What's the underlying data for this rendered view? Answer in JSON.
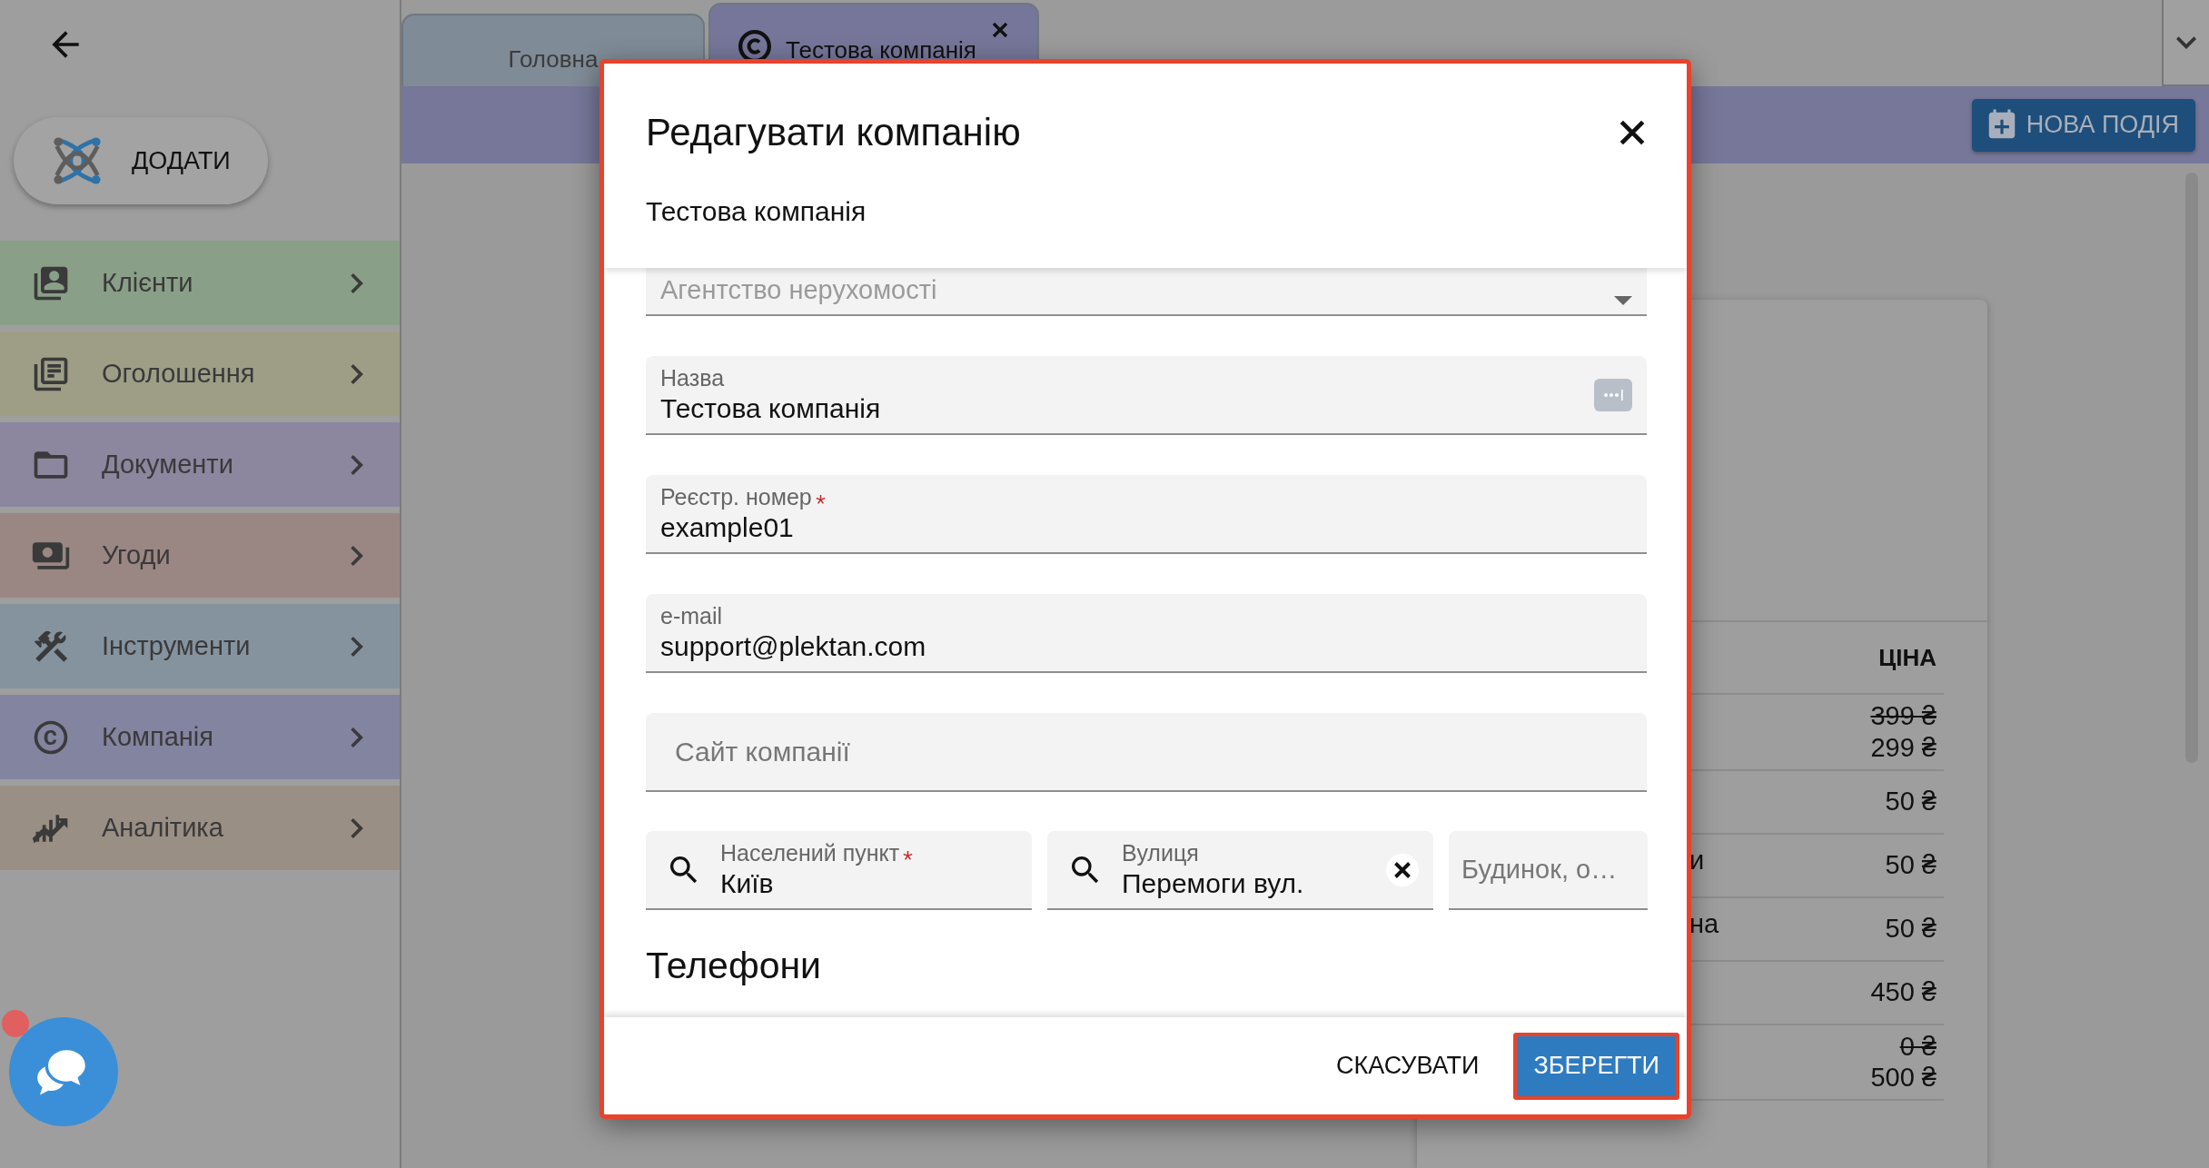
{
  "add_button": {
    "label": "ДОДАТИ"
  },
  "sidebar": {
    "items": [
      {
        "label": "Клієнти",
        "color": "#8a9f87"
      },
      {
        "label": "Оголошення",
        "color": "#9e9e87"
      },
      {
        "label": "Документи",
        "color": "#8d869f"
      },
      {
        "label": "Угоди",
        "color": "#9a8683"
      },
      {
        "label": "Інструменти",
        "color": "#85939f"
      },
      {
        "label": "Компанія",
        "color": "#83849f"
      },
      {
        "label": "Аналітика",
        "color": "#9a8f85"
      }
    ]
  },
  "tabs": [
    {
      "label": "Головна",
      "selected": false,
      "closable": false
    },
    {
      "label": "Тестова компанія",
      "selected": true,
      "closable": true
    }
  ],
  "toolbar": {
    "new_event_button": "НОВА ПОДІЯ"
  },
  "table": {
    "columns": [
      "ЦІНА"
    ],
    "rows": [
      {
        "old_price": "399 ₴",
        "price": "299 ₴"
      },
      {
        "price": "50 ₴"
      },
      {
        "fragment": "и",
        "price": "50 ₴"
      },
      {
        "fragment": "на",
        "price": "50 ₴"
      },
      {
        "price": "450 ₴"
      },
      {
        "old_price": "0 ₴",
        "price": "500 ₴"
      }
    ]
  },
  "dialog": {
    "title": "Редагувати компанію",
    "subtitle": "Тестова компанія",
    "highlighted": true,
    "fields": [
      {
        "kind": "select",
        "value": "Агентство нерухомості",
        "disabled": true
      },
      {
        "kind": "text",
        "label": "Назва",
        "value": "Тестова компанія",
        "required": false,
        "autofill": true
      },
      {
        "kind": "text",
        "label": "Реєстр. номер",
        "value": "example01",
        "required": true,
        "autofill": false
      },
      {
        "kind": "text",
        "label": "e-mail",
        "value": "support@plektan.com",
        "required": false,
        "autofill": false
      },
      {
        "kind": "text",
        "placeholder": "Сайт компанії"
      }
    ],
    "address": [
      {
        "label": "Населений пункт",
        "value": "Київ",
        "required": true,
        "search": true,
        "clearable": false
      },
      {
        "label": "Вулиця",
        "value": "Перемоги вул.",
        "required": false,
        "search": true,
        "clearable": true
      },
      {
        "placeholder": "Будинок, о…",
        "search": false,
        "clearable": false
      }
    ],
    "section": "Телефони",
    "buttons": [
      {
        "label": "СКАСУВАТИ",
        "kind": "text",
        "highlighted": false
      },
      {
        "label": "ЗБЕРЕГТИ",
        "kind": "primary",
        "highlighted": true
      }
    ]
  },
  "chat": {
    "unread": true
  }
}
